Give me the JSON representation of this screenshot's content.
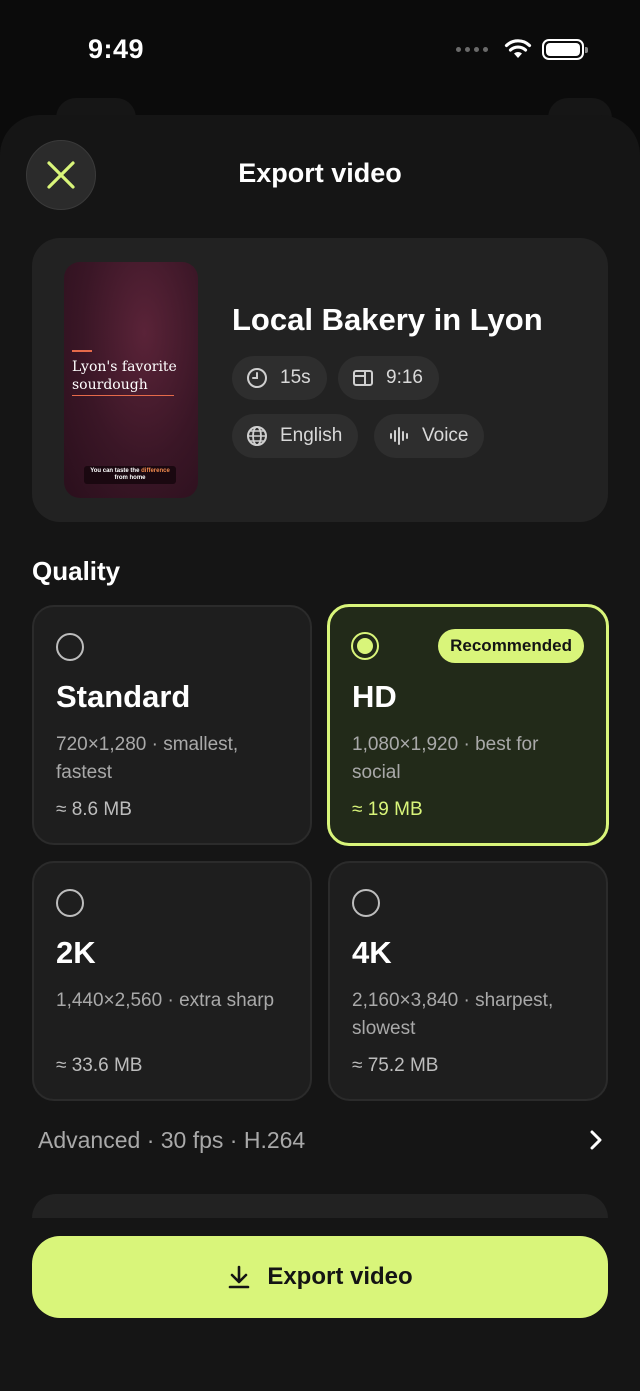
{
  "status_bar": {
    "time": "9:49"
  },
  "header": {
    "title": "Export video",
    "close_icon": "close-icon"
  },
  "project": {
    "title": "Local Bakery in Lyon",
    "thumbnail": {
      "title": "Lyon's favorite sourdough",
      "caption_prefix": "You can taste the ",
      "caption_highlight": "difference",
      "caption_suffix": " from home"
    },
    "chips": [
      {
        "icon": "clock-icon",
        "label": "15s"
      },
      {
        "icon": "aspect-ratio-icon",
        "label": "9:16"
      },
      {
        "icon": "globe-icon",
        "label": "English"
      },
      {
        "icon": "waveform-icon",
        "label": "Voice"
      }
    ]
  },
  "quality": {
    "label": "Quality",
    "selected": "HD",
    "options": [
      {
        "name": "Standard",
        "description": "720×1,280 · smallest, fastest",
        "size": "≈ 8.6 MB",
        "selected": false,
        "badge": ""
      },
      {
        "name": "HD",
        "description": "1,080×1,920 · best for social",
        "size": "≈ 19 MB",
        "selected": true,
        "badge": "Recommended"
      },
      {
        "name": "2K",
        "description": "1,440×2,560 · extra sharp",
        "size": "≈ 33.6 MB",
        "selected": false,
        "badge": ""
      },
      {
        "name": "4K",
        "description": "2,160×3,840 · sharpest, slowest",
        "size": "≈ 75.2 MB",
        "selected": false,
        "badge": ""
      }
    ]
  },
  "advanced": {
    "label": "Advanced · 30 fps · H.264"
  },
  "export_button": {
    "label": "Export video",
    "icon": "download-icon"
  },
  "colors": {
    "accent": "#d9f57a",
    "background": "#0b0b0b",
    "sheet": "#151515",
    "card": "#222222"
  }
}
